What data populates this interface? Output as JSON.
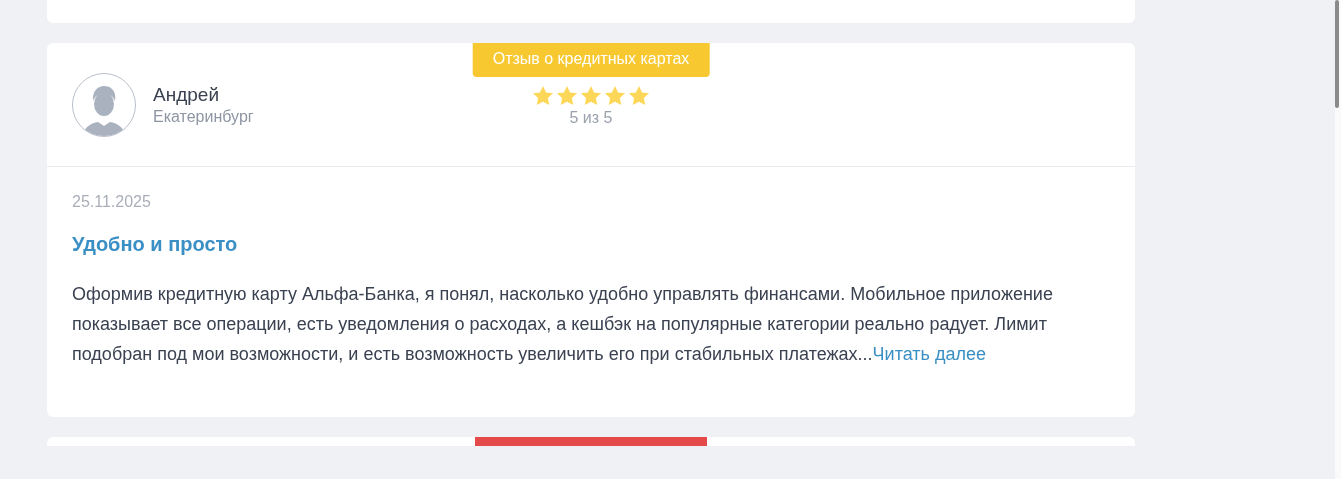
{
  "reviews": [
    {
      "kind": "stub"
    },
    {
      "kind": "full",
      "badge": {
        "label": "Отзыв о кредитных картах",
        "color": "#f7c830"
      },
      "author": {
        "name": "Андрей",
        "city": "Екатеринбург"
      },
      "stars": 5,
      "rating_text": "5 из 5",
      "date": "25.11.2025",
      "title": "Удобно и просто",
      "text": "Оформив кредитную карту Альфа-Банка, я понял, насколько удобно управлять финансами. Мобильное приложение показывает все операции, есть уведомления о расходах, а кешбэк на популярные категории реально радует. Лимит подобран под мои возможности, и есть возможность увеличить его при стабильных платежах...",
      "more_link": "Читать далее"
    },
    {
      "kind": "badge_stub",
      "badge": {
        "color": "#e44a4a"
      }
    }
  ]
}
